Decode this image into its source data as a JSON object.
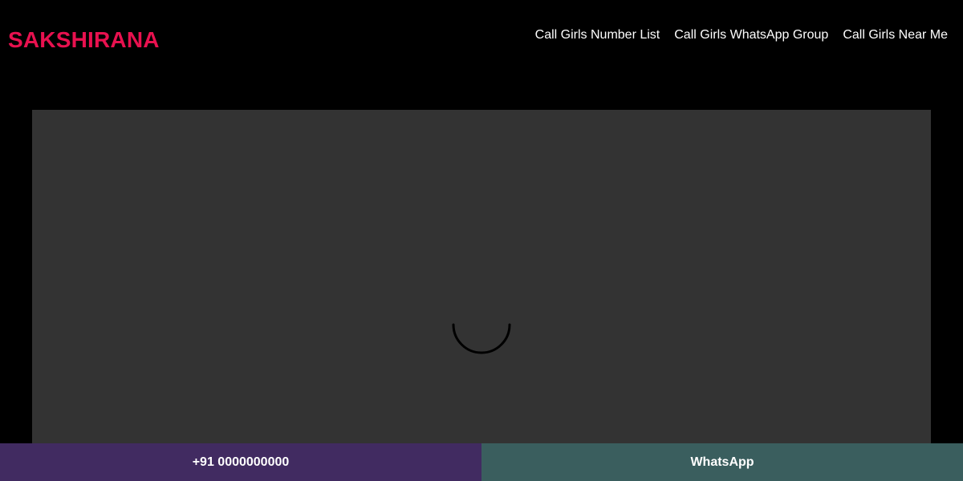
{
  "header": {
    "logo": "SAKSHIRANA",
    "nav": [
      {
        "label": "Call Girls Number List"
      },
      {
        "label": "Call Girls WhatsApp Group"
      },
      {
        "label": "Call Girls Near Me"
      }
    ]
  },
  "main": {
    "spinner_icon": "loading-spinner-icon"
  },
  "bottom_bar": {
    "call_label": "+91 0000000000",
    "whatsapp_label": "WhatsApp"
  },
  "colors": {
    "background": "#000000",
    "logo": "#e8114f",
    "media_placeholder": "#333333",
    "call_button": "#412b61",
    "whatsapp_button": "#3a5e5e"
  }
}
